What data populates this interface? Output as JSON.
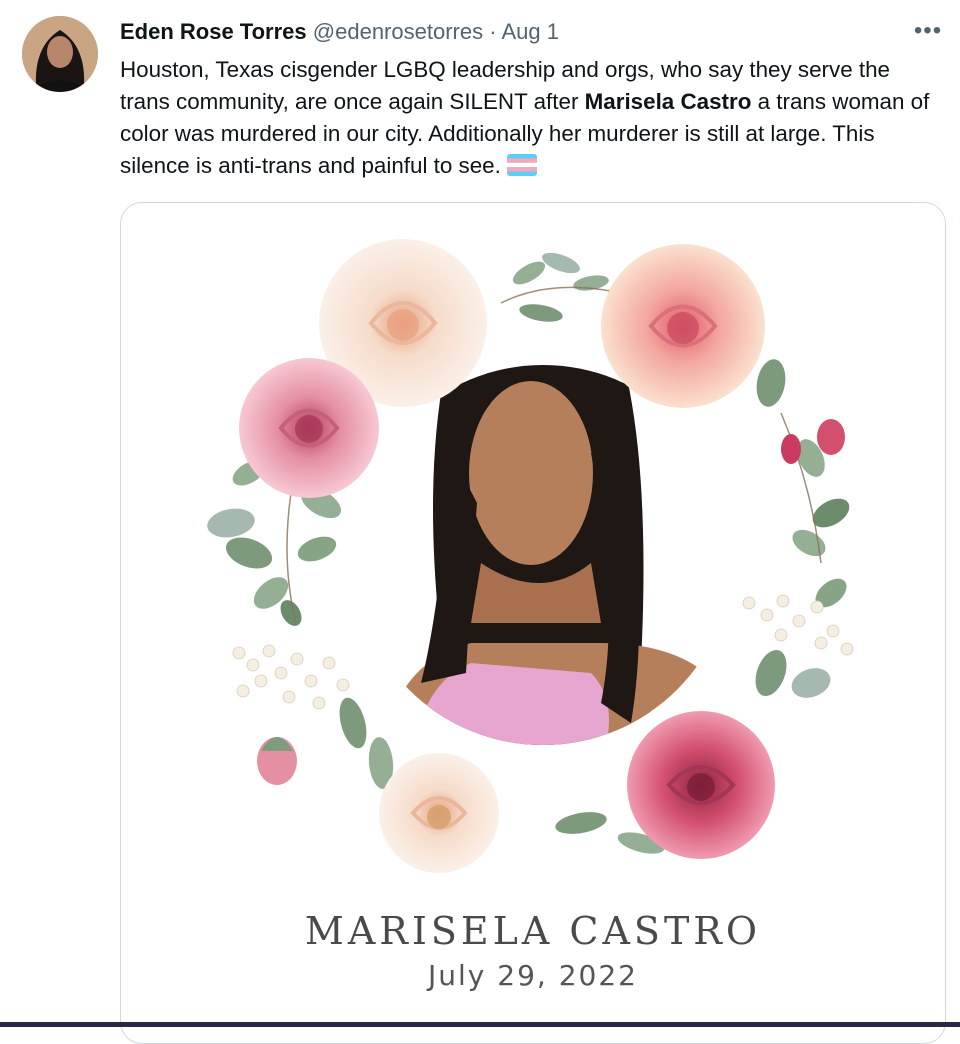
{
  "tweet": {
    "author_name": "Eden Rose Torres",
    "handle": "@edenrosetorres",
    "separator": "·",
    "date": "Aug 1",
    "more_label": "•••",
    "text_part1": "Houston, Texas cisgender LGBQ leadership and orgs, who say they serve the trans community, are once again SILENT after ",
    "text_bold": "Marisela Castro",
    "text_part2": " a trans woman of color was murdered in our city. Additionally her murderer is still at large. This silence is anti-trans and painful to see.",
    "emoji": "transgender-flag-emoji"
  },
  "media": {
    "name": "MARISELA CASTRO",
    "date": "July 29, 2022"
  },
  "colors": {
    "rose_pink": "#e58fa3",
    "rose_cream": "#f6dccb",
    "rose_deep": "#d24f6e",
    "leaf_green": "#7f9c7c",
    "shirt_pink": "#e6a6cf",
    "hair": "#1e1714",
    "skin": "#b57f5b"
  }
}
